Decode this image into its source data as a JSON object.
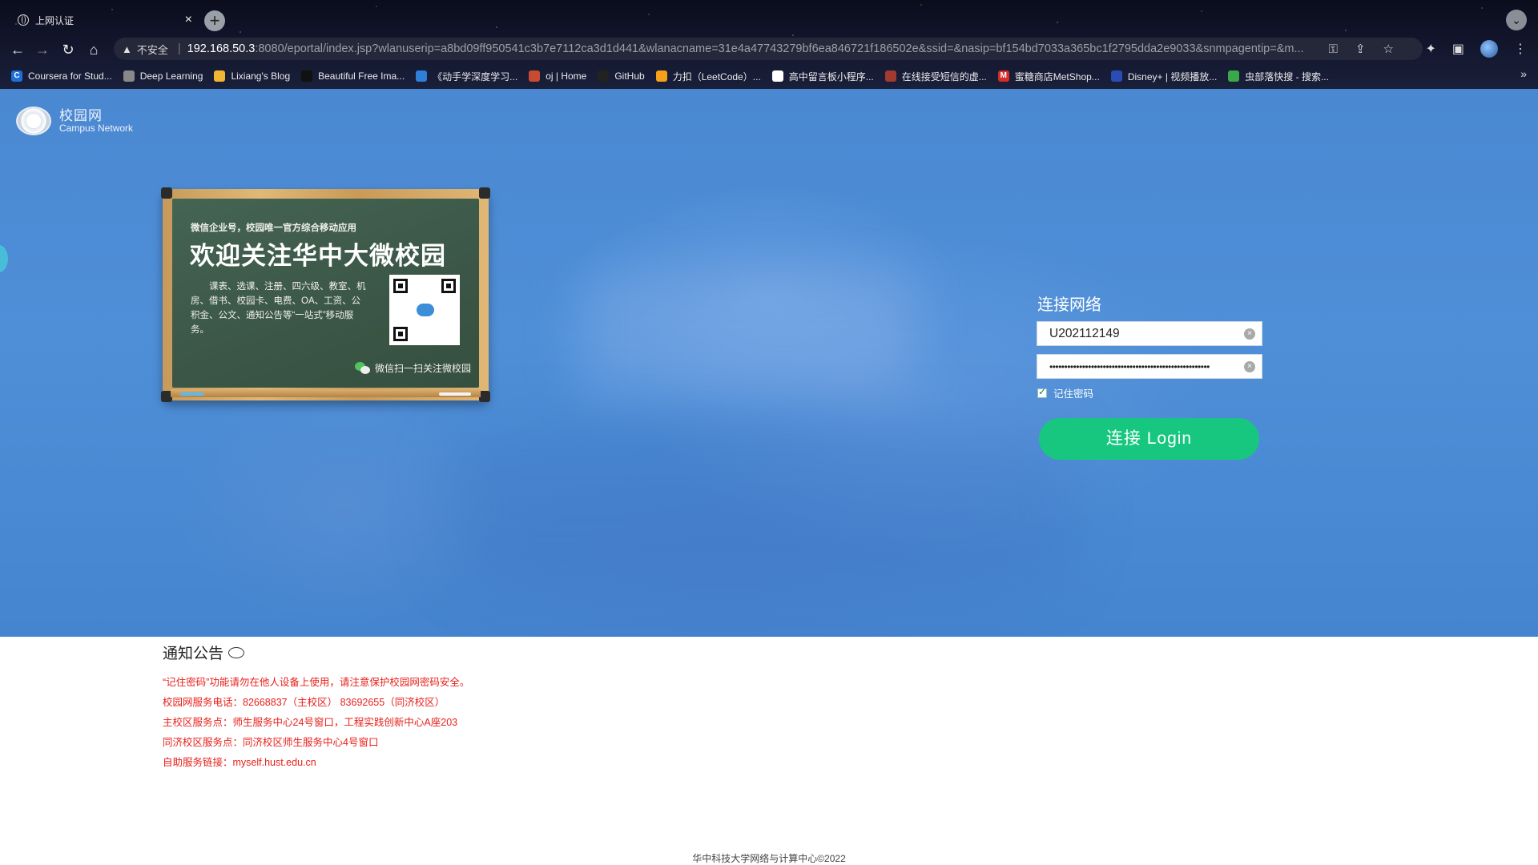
{
  "browser": {
    "tab_title": "上网认证",
    "tab_close": "×",
    "new_tab": "+",
    "insecure_label": "不安全",
    "url_host": "192.168.50.3",
    "url_path": ":8080/eportal/index.jsp?wlanuserip=a8bd09ff950541c3b7e7112ca3d1d441&wlanacname=31e4a47743279bf6ea846721f186502e&ssid=&nasip=bf154bd7033a365bc1f2795dda2e9033&snmpagentip=&m...",
    "bookmarks": [
      {
        "label": "Coursera for Stud...",
        "icon": "coursera-icon",
        "icon_text": "C",
        "color": "#1f6fd6"
      },
      {
        "label": "Deep Learning",
        "icon": "globe-icon",
        "icon_text": "",
        "color": "#888888"
      },
      {
        "label": "Lixiang's Blog",
        "icon": "sun-icon",
        "icon_text": "",
        "color": "#f2b533"
      },
      {
        "label": "Beautiful Free Ima...",
        "icon": "unsplash-icon",
        "icon_text": "",
        "color": "#111111"
      },
      {
        "label": "《动手学深度学习...",
        "icon": "d2l-icon",
        "icon_text": "",
        "color": "#2f7fd8"
      },
      {
        "label": "oj | Home",
        "icon": "oj-icon",
        "icon_text": "",
        "color": "#c84b2f"
      },
      {
        "label": "GitHub",
        "icon": "github-icon",
        "icon_text": "",
        "color": "#222222"
      },
      {
        "label": "力扣（LeetCode）...",
        "icon": "leetcode-icon",
        "icon_text": "",
        "color": "#f89f1b"
      },
      {
        "label": "高中留言板小程序...",
        "icon": "notion-icon",
        "icon_text": "N",
        "color": "#ffffff"
      },
      {
        "label": "在线接受短信的虚...",
        "icon": "sms-icon",
        "icon_text": "",
        "color": "#a23b2f"
      },
      {
        "label": "蜜糖商店MetShop...",
        "icon": "metshop-icon",
        "icon_text": "M",
        "color": "#d42b2b"
      },
      {
        "label": "Disney+ | 视频播放...",
        "icon": "disney-icon",
        "icon_text": "",
        "color": "#2a4cb5"
      },
      {
        "label": "虫部落快搜 - 搜索...",
        "icon": "search-bug-icon",
        "icon_text": "",
        "color": "#3aa74a"
      }
    ],
    "bookmarks_more": "»"
  },
  "logo": {
    "cn": "校园网",
    "en": "Campus Network"
  },
  "board": {
    "subtitle": "微信企业号，校园唯一官方综合移动应用",
    "title": "欢迎关注华中大微校园",
    "body": "课表、选课、注册、四六级、教室、机房、借书、校园卡、电费、OA、工资、公积金、公文、通知公告等“一站式”移动服务。",
    "wechat_text": "微信扫一扫关注微校园"
  },
  "login": {
    "heading": "连接网络",
    "username": "U202112149",
    "password_mask": "••••••••••••••••••••••••••••••••••••••••••••••••••••••",
    "remember_label": "记住密码",
    "remember_checked": true,
    "button_label": "连接 Login",
    "button_color": "#17c77f"
  },
  "notice": {
    "heading": "通知公告",
    "items": [
      "“记住密码”功能请勿在他人设备上使用，请注意保护校园网密码安全。",
      "校园网服务电话：82668837（主校区） 83692655（同济校区）",
      "主校区服务点：师生服务中心24号窗口，工程实践创新中心A座203",
      "同济校区服务点：同济校区师生服务中心4号窗口",
      "自助服务链接：myself.hust.edu.cn"
    ],
    "color": "#e8201a"
  },
  "footer": "华中科技大学网络与计算中心©2022"
}
